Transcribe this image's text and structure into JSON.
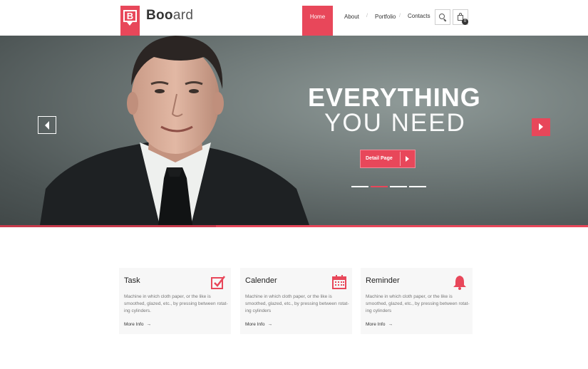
{
  "header": {
    "logo_letter": "B",
    "brand_bold": "Boo",
    "brand_rest": "ard",
    "nav": [
      "Home",
      "About",
      "Portfolio",
      "Contacts"
    ],
    "nav_separator": "/",
    "cart_count": "0",
    "icons": [
      "search-icon",
      "cart-icon"
    ]
  },
  "hero": {
    "title": "EVERYTHING",
    "subtitle": "YOU NEED",
    "button_label": "Detail Page",
    "slides_count": 4,
    "active_slide": 2
  },
  "features": [
    {
      "title": "Task",
      "icon": "checkbox-icon",
      "desc": "Machine in which cloth paper, or the like is smoothed, glazed, etc., by pressing between rotat-ing cylinders.",
      "more": "More Info"
    },
    {
      "title": "Calender",
      "icon": "calendar-icon",
      "desc": "Machine in which cloth paper, or the like is smoothed, glazed, etc., by pressing between rotat-ing cylinders",
      "more": "More Info"
    },
    {
      "title": "Reminder",
      "icon": "bell-icon",
      "desc": "Machine in which cloth paper, or the like is smoothed, glazed, etc., by pressing between rotat-ing cylinders",
      "more": "More Info"
    }
  ],
  "colors": {
    "accent": "#e8475a",
    "hero_bg": "#6f7978",
    "card_bg": "#f7f7f7"
  }
}
